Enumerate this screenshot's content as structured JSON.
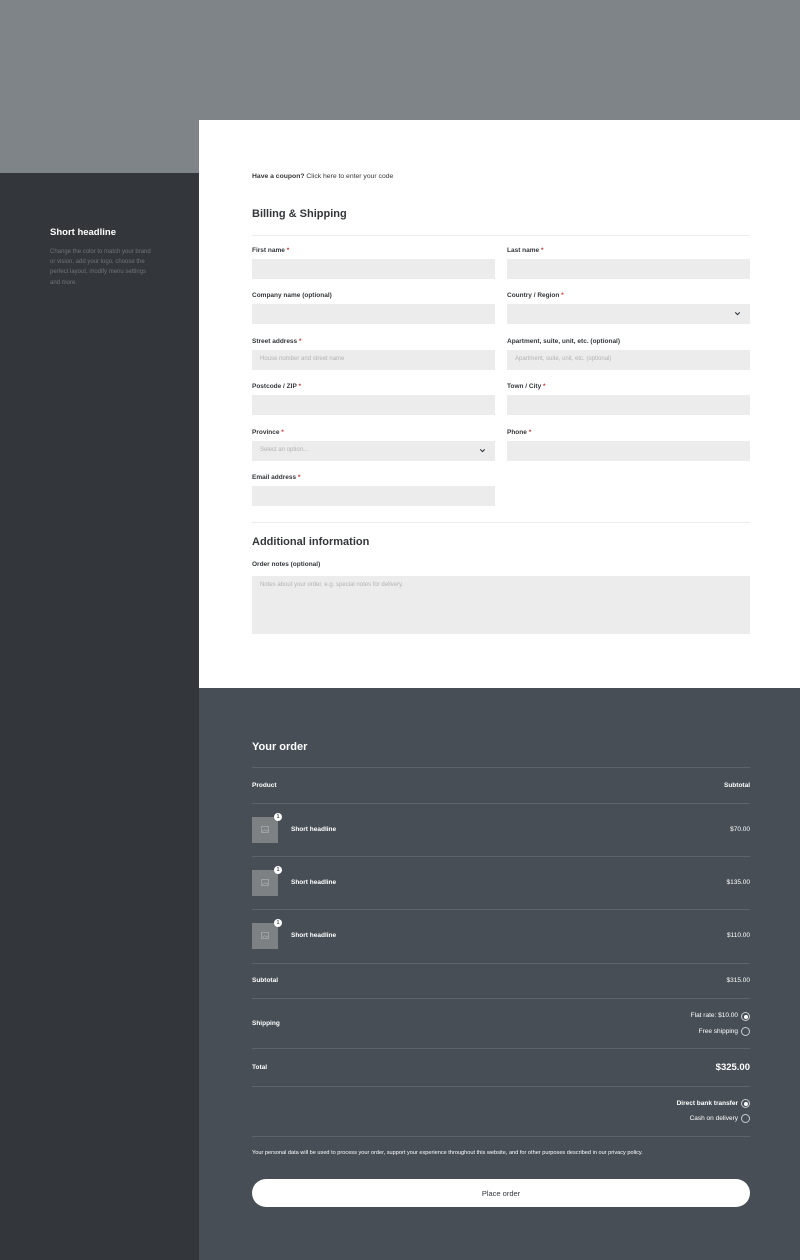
{
  "sidebar": {
    "title": "Short headline",
    "description": "Change the color to match your brand or vision, add your logo, choose the perfect layout, modify menu settings and more."
  },
  "coupon": {
    "prompt": "Have a coupon?",
    "link": "Click here to enter your code"
  },
  "billing": {
    "title": "Billing & Shipping",
    "required_mark": "*",
    "fields": {
      "first_name": {
        "label": "First name"
      },
      "last_name": {
        "label": "Last name"
      },
      "company": {
        "label": "Company name (optional)"
      },
      "country": {
        "label": "Country / Region"
      },
      "street": {
        "label": "Street address",
        "placeholder": "House number and street name"
      },
      "apartment": {
        "label": "Apartment, suite, unit, etc. (optional)",
        "placeholder": "Apartment, suite, unit, etc. (optional)"
      },
      "postcode": {
        "label": "Postcode / ZIP"
      },
      "town": {
        "label": "Town / City"
      },
      "province": {
        "label": "Province",
        "placeholder": "Select an option..."
      },
      "phone": {
        "label": "Phone"
      },
      "email": {
        "label": "Email address"
      }
    }
  },
  "additional": {
    "title": "Additional information",
    "notes_label": "Order notes (optional)",
    "notes_placeholder": "Notes about your order, e.g. special notes for delivery."
  },
  "order": {
    "title": "Your order",
    "col_product": "Product",
    "col_subtotal": "Subtotal",
    "items": [
      {
        "name": "Short headline",
        "qty": "1",
        "price": "$70.00"
      },
      {
        "name": "Short headline",
        "qty": "1",
        "price": "$135.00"
      },
      {
        "name": "Short headline",
        "qty": "1",
        "price": "$110.00"
      }
    ],
    "subtotal_label": "Subtotal",
    "subtotal_value": "$315.00",
    "shipping_label": "Shipping",
    "shipping_options": [
      {
        "label": "Flat rate: $10.00",
        "selected": true
      },
      {
        "label": "Free shipping",
        "selected": false
      }
    ],
    "total_label": "Total",
    "total_value": "$325.00",
    "payment_options": [
      {
        "label": "Direct bank transfer",
        "selected": true
      },
      {
        "label": "Cash on delivery",
        "selected": false
      }
    ],
    "privacy_text": "Your personal data will be used to process your order, support your experience throughout this website, and for other purposes described in our privacy policy.",
    "place_order_label": "Place order"
  },
  "colors": {
    "top_band": "#7f8488",
    "sidebar": "#33373b",
    "order_panel": "#474e55",
    "input_bg": "#ececec",
    "required": "#d0312d"
  }
}
